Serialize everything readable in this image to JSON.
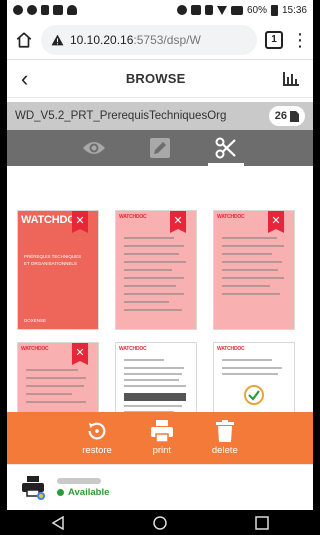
{
  "status_bar": {
    "battery": "60%",
    "time": "15:36"
  },
  "browser": {
    "url_host": "10.10.20.16",
    "url_path": ":5753/dsp/W",
    "tab_count": "1"
  },
  "app": {
    "title": "BROWSE"
  },
  "file": {
    "name": "WD_V5.2_PRT_PrerequisTechniquesOrg",
    "pages": "26"
  },
  "modes": [
    {
      "name": "preview",
      "icon": "eye-icon"
    },
    {
      "name": "edit",
      "icon": "pencil-icon"
    },
    {
      "name": "cut",
      "icon": "scissors-icon",
      "active": true
    }
  ],
  "thumbnails": {
    "cover_brand": "WATCHDOC",
    "cover_title_1": "PRÉREQUIS TECHNIQUES",
    "cover_title_2": "ET ORGANISATIONNELS",
    "cover_footer": "DOXENSE",
    "page_brand": "WATCHDOC"
  },
  "actions": [
    {
      "label": "restore",
      "icon": "restore-icon"
    },
    {
      "label": "print",
      "icon": "printer-icon"
    },
    {
      "label": "delete",
      "icon": "trash-icon"
    }
  ],
  "printer": {
    "status": "Available"
  },
  "colors": {
    "accent": "#f47a3a",
    "selected": "#e8263a",
    "mode_bar": "#6d6d6d",
    "available": "#2e9b3a"
  }
}
